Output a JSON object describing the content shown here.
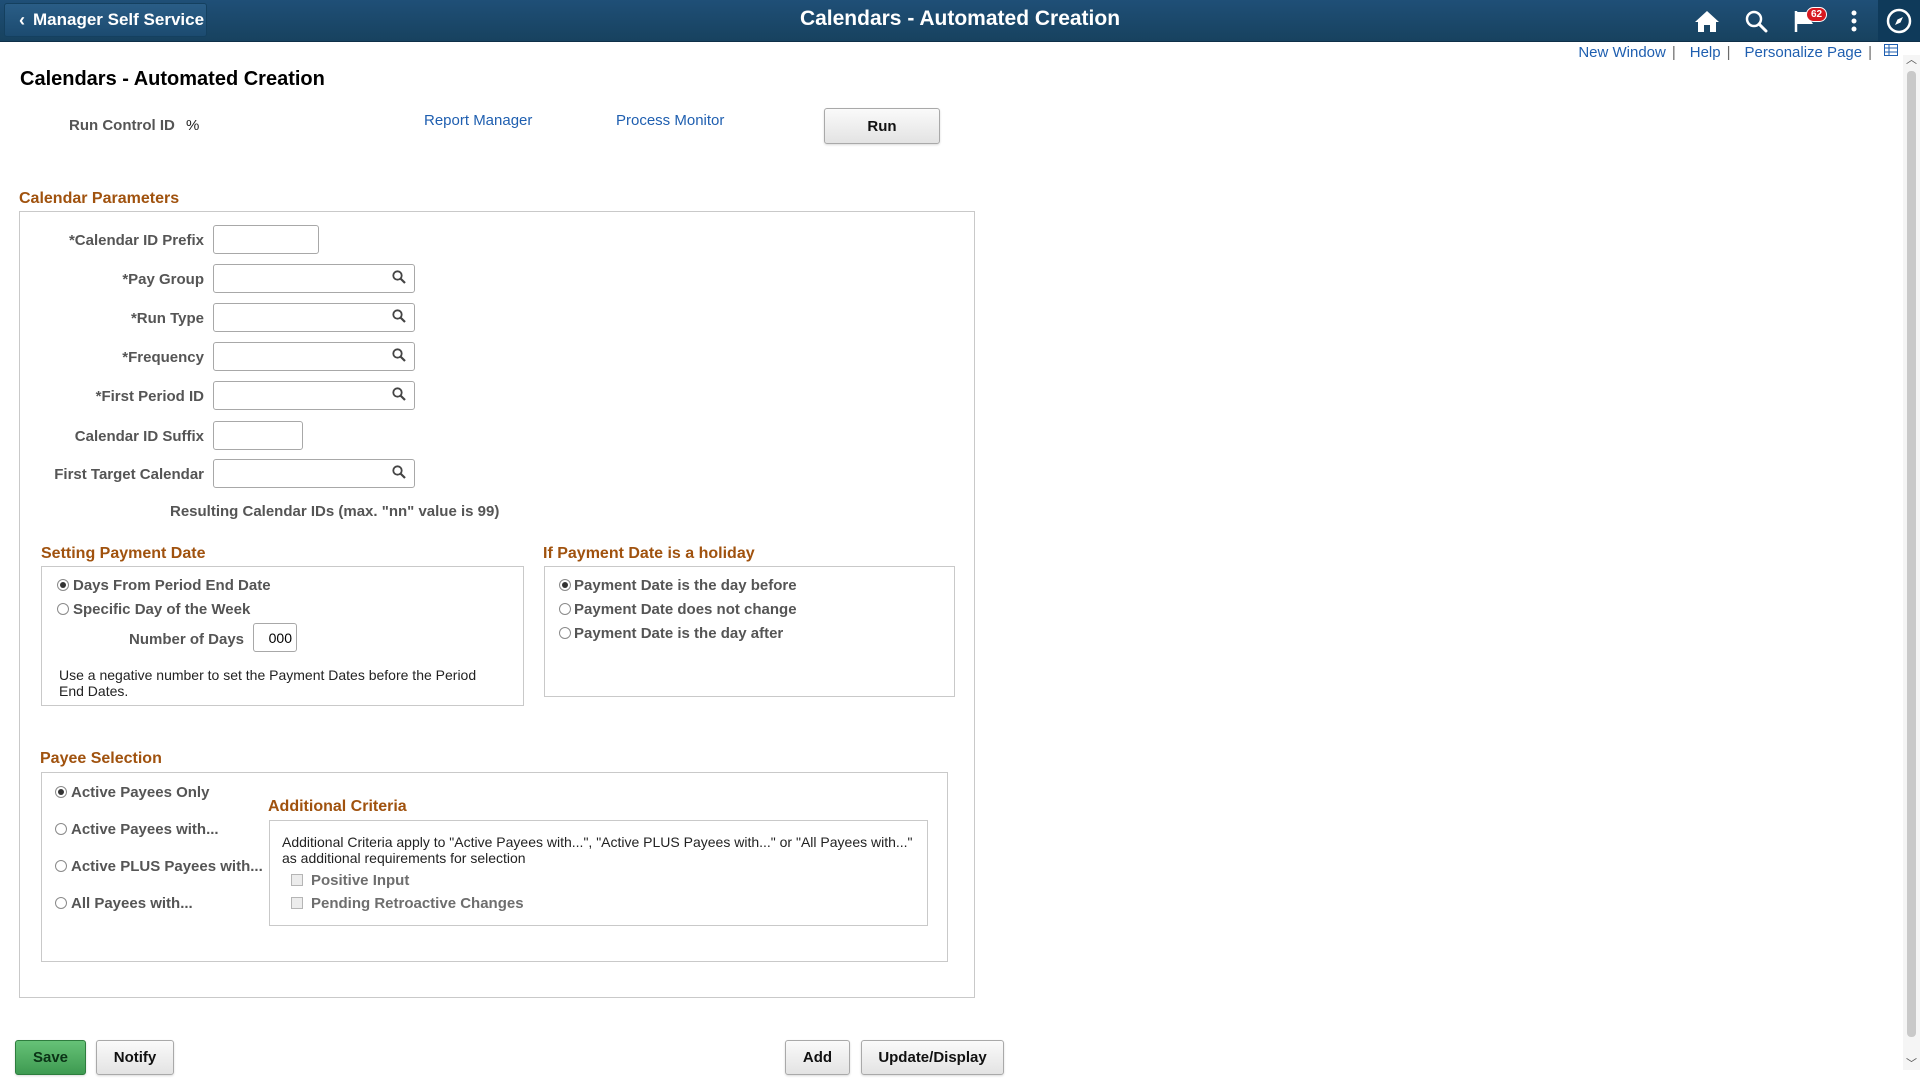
{
  "header": {
    "back_label": "Manager Self Service",
    "title": "Calendars - Automated Creation",
    "notification_count": "62",
    "icons": [
      "home-icon",
      "search-icon",
      "notification-flag-icon",
      "actions-menu-icon",
      "navbar-compass-icon"
    ]
  },
  "utility_links": {
    "new_window": "New Window",
    "help": "Help",
    "personalize": "Personalize Page",
    "separator": "|"
  },
  "page": {
    "title": "Calendars - Automated Creation",
    "run_control_label": "Run Control ID",
    "run_control_value": "%",
    "report_manager": "Report Manager",
    "process_monitor": "Process Monitor",
    "run_button": "Run"
  },
  "calendar_parameters": {
    "title": "Calendar Parameters",
    "fields": {
      "prefix": "*Calendar ID Prefix",
      "pay_group": "*Pay Group",
      "run_type": "*Run Type",
      "frequency": "*Frequency",
      "first_period": "*First Period ID",
      "suffix": "Calendar ID Suffix",
      "first_target": "First Target Calendar"
    },
    "resulting_note": "Resulting Calendar IDs (max. \"nn\" value is 99)"
  },
  "setting_payment_date": {
    "title": "Setting Payment Date",
    "options": [
      "Days From Period End Date",
      "Specific Day of the Week"
    ],
    "selected": "Days From Period End Date",
    "number_of_days_label": "Number of Days",
    "number_of_days_value": "000",
    "note": "Use a negative number to set the Payment Dates before the Period End Dates."
  },
  "holiday": {
    "title": "If Payment Date is a holiday",
    "options": [
      "Payment Date is the day before",
      "Payment Date does not change",
      "Payment Date is the day after"
    ],
    "selected": "Payment Date is the day before"
  },
  "payee_selection": {
    "title": "Payee Selection",
    "options": [
      "Active Payees Only",
      "Active Payees with...",
      "Active PLUS Payees with...",
      "All Payees with..."
    ],
    "selected": "Active Payees Only",
    "additional_criteria": {
      "title": "Additional Criteria",
      "note": "Additional Criteria apply to \"Active Payees with...\", \"Active PLUS Payees with...\" or \"All Payees with...\" as additional requirements for selection",
      "checks": [
        "Positive Input",
        "Pending Retroactive Changes"
      ]
    }
  },
  "footer": {
    "save": "Save",
    "notify": "Notify",
    "add": "Add",
    "update_display": "Update/Display"
  },
  "colors": {
    "header_bg": "#1f4f77",
    "section_title": "#a0520e",
    "link": "#1f5fb0",
    "save_button": "#4caf60"
  }
}
